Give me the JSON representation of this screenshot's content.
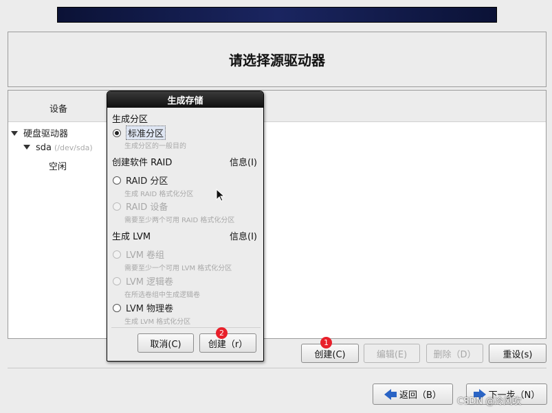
{
  "page": {
    "title": "请选择源驱动器"
  },
  "device_list": {
    "column_header": "设备",
    "tree": [
      {
        "label": "硬盘驱动器",
        "detail": ""
      },
      {
        "label": "sda",
        "detail": "(/dev/sda)"
      },
      {
        "label": "空闲",
        "detail": ""
      }
    ]
  },
  "action_buttons": {
    "create": "创建(C)",
    "edit": "编辑(E)",
    "delete": "删除（D）",
    "reset": "重设(s)"
  },
  "nav_buttons": {
    "back": "返回（B）",
    "next": "下一步（N）"
  },
  "badges": {
    "badge1": "1",
    "badge2": "2"
  },
  "dialog": {
    "title": "生成存储",
    "section_partition": "生成分区",
    "standard_partition": "标准分区",
    "standard_partition_desc": "生成分区的一般目的",
    "section_raid": "创建软件 RAID",
    "info_raid": "信息(I)",
    "raid_partition": "RAID 分区",
    "raid_partition_desc": "生成 RAID 格式化分区",
    "raid_device": "RAID 设备",
    "raid_device_desc": "需要至少两个可用 RAID 格式化分区",
    "section_lvm": "生成 LVM",
    "info_lvm": "信息(I)",
    "lvm_vg": "LVM 卷组",
    "lvm_vg_desc": "需要至少一个可用 LVM 格式化分区",
    "lvm_lv": "LVM 逻辑卷",
    "lvm_lv_desc": "在所选卷组中生成逻辑卷",
    "lvm_pv": "LVM 物理卷",
    "lvm_pv_desc": "生成 LVM 格式化分区",
    "cancel": "取消(C)",
    "create": "创建（r）"
  },
  "watermark": "CSDN @冷风吹",
  "colors": {
    "top_bar": "#0b1236",
    "badge": "#e8202b",
    "arrow": "#2a64c5",
    "dialog_title_bg": "#101010"
  }
}
